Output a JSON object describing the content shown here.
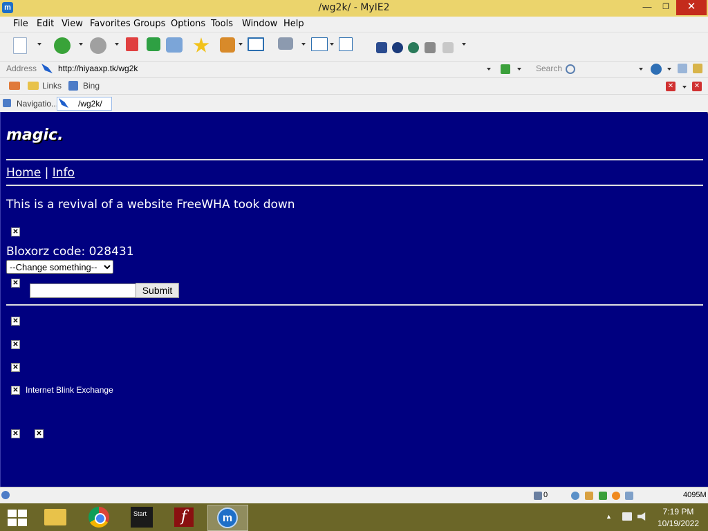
{
  "window": {
    "title": "/wg2k/ - MyIE2",
    "app_icon_glyph": "m",
    "minimize_glyph": "—",
    "maximize_glyph": "❐",
    "close_glyph": "✕"
  },
  "menu": [
    "File",
    "Edit",
    "View",
    "Favorites",
    "Groups",
    "Options",
    "Tools",
    "Window",
    "Help"
  ],
  "address": {
    "label": "Address",
    "url": "http://hiyaaxp.tk/wg2k",
    "search_label": "Search"
  },
  "links_bar": {
    "items": [
      "Links",
      "Bing"
    ]
  },
  "tabs": [
    {
      "label": "Navigatio...",
      "active": false
    },
    {
      "label": "/wg2k/",
      "active": true
    }
  ],
  "page": {
    "site_title": "magic.",
    "nav": {
      "home": "Home",
      "separator": "|",
      "info": "Info"
    },
    "intro": "This is a revival of a website FreeWHA took down",
    "broken_image_glyph": "✕",
    "bloxorz_code": "Bloxorz code: 028431",
    "select_value": "--Change something--",
    "text_input_value": "",
    "submit_label": "Submit",
    "blink_exchange": "Internet Blink Exchange"
  },
  "status_bar": {
    "trash_count": "0",
    "memory": "4095M"
  },
  "taskbar": {
    "start_tile_label": "Start",
    "time": "7:19 PM",
    "date": "10/19/2022",
    "tray_up_glyph": "▲",
    "flash_glyph": "f",
    "myie_glyph": "m"
  },
  "colors": {
    "page_background": "#000080",
    "title_bar": "#EBD46C",
    "taskbar": "#6B6628",
    "close_button": "#C42B1C"
  },
  "icons": [
    "new-page-icon",
    "back-icon",
    "forward-icon",
    "stop-icon",
    "refresh-icon",
    "home-icon",
    "favorites-star-icon",
    "groups-icon",
    "window-icon",
    "undo-icon",
    "columns-icon",
    "panel-icon",
    "go-icon",
    "search-icon",
    "folder-icon"
  ]
}
